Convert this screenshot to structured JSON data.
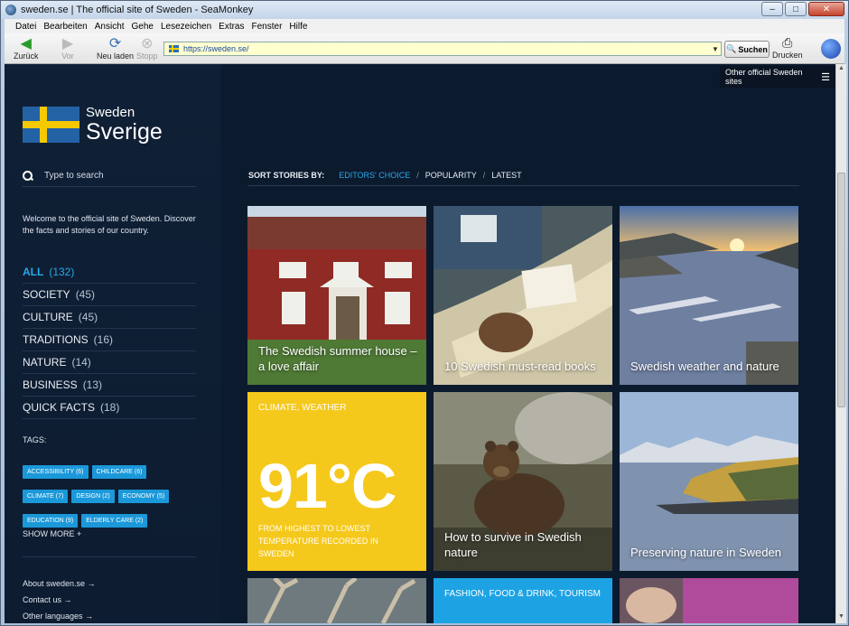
{
  "window": {
    "title": "sweden.se | The official site of Sweden - SeaMonkey",
    "buttons": {
      "minimize": "–",
      "maximize": "□",
      "close": "✕"
    }
  },
  "menu": [
    "Datei",
    "Bearbeiten",
    "Ansicht",
    "Gehe",
    "Lesezeichen",
    "Extras",
    "Fenster",
    "Hilfe"
  ],
  "toolbar": {
    "back": "Zurück",
    "forward": "Vor",
    "reload": "Neu laden",
    "stop": "Stopp",
    "url": "https://sweden.se/",
    "search": "Suchen",
    "print": "Drucken"
  },
  "site": {
    "other_sites": "Other official Sweden sites",
    "logo_line1": "Sweden",
    "logo_line2": "Sverige",
    "search_placeholder": "Type to search",
    "welcome": "Welcome to the official site of Sweden. Discover the facts and stories of our country.",
    "categories": [
      {
        "label": "ALL",
        "count": "(132)"
      },
      {
        "label": "SOCIETY",
        "count": "(45)"
      },
      {
        "label": "CULTURE",
        "count": "(45)"
      },
      {
        "label": "TRADITIONS",
        "count": "(16)"
      },
      {
        "label": "NATURE",
        "count": "(14)"
      },
      {
        "label": "BUSINESS",
        "count": "(13)"
      },
      {
        "label": "QUICK FACTS",
        "count": "(18)"
      }
    ],
    "tags_heading": "TAGS:",
    "tags": [
      "ACCESSIBILITY (6)",
      "CHILDCARE (6)",
      "CLIMATE (7)",
      "DESIGN (2)",
      "ECONOMY (5)",
      "EDUCATION (9)",
      "ELDERLY CARE (2)"
    ],
    "show_more": "SHOW MORE",
    "links": [
      "About sweden.se",
      "Contact us",
      "Other languages"
    ],
    "sort": {
      "label": "SORT STORIES BY:",
      "options": [
        "EDITORS' CHOICE",
        "POPULARITY",
        "LATEST"
      ],
      "separator": "/"
    },
    "cards": [
      {
        "caption": "The Swedish summer house – a love affair"
      },
      {
        "caption": "10 Swedish must-read books"
      },
      {
        "caption": "Swedish weather and nature"
      },
      {
        "category": "CLIMATE, WEATHER",
        "big": "91°C",
        "text": "FROM HIGHEST TO LOWEST TEMPERATURE RECORDED IN SWEDEN"
      },
      {
        "caption": "How to survive in Swedish nature"
      },
      {
        "caption": "Preserving nature in Sweden"
      },
      {
        "category": "FASHION, FOOD & DRINK, TOURISM"
      }
    ]
  },
  "colors": {
    "accent": "#27a8e8",
    "bg": "#0c1a2e",
    "yellow": "#f5c81c",
    "tag": "#1b98d9"
  }
}
